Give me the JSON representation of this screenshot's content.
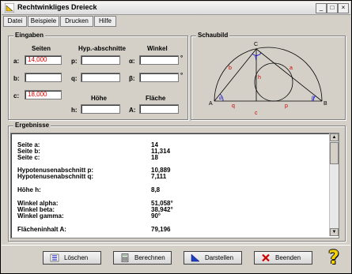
{
  "window": {
    "title": "Rechtwinkliges Dreieck"
  },
  "menu": [
    "Datei",
    "Beispiele",
    "Drucken",
    "Hilfe"
  ],
  "eingaben": {
    "title": "Eingaben",
    "col_seiten": "Seiten",
    "col_hyp": "Hyp.-abschnitte",
    "col_winkel": "Winkel",
    "row_a": "a:",
    "row_b": "b:",
    "row_c": "c:",
    "p_label": "p:",
    "q_label": "q:",
    "alpha_label": "α:",
    "beta_label": "β:",
    "deg1": "°",
    "deg2": "°",
    "hoehe_title": "Höhe",
    "flaeche_title": "Fläche",
    "h_label": "h:",
    "A_label": "A:",
    "a_value": "14,000",
    "b_value": "",
    "c_value": "18,000",
    "p_value": "",
    "q_value": "",
    "alpha_value": "",
    "beta_value": "",
    "h_value": "",
    "A_value": ""
  },
  "schaubild": {
    "title": "Schaubild",
    "vertex_A": "A",
    "vertex_B": "B",
    "vertex_C": "C",
    "side_a": "a",
    "side_b": "b",
    "side_c": "c",
    "seg_p": "p",
    "seg_q": "q",
    "height": "h",
    "angle_alpha": "α",
    "angle_beta": "β",
    "angle_gamma": "γ"
  },
  "ergebnisse": {
    "title": "Ergebnisse",
    "rows": [
      {
        "label": "Seite a:",
        "value": "14"
      },
      {
        "label": "Seite b:",
        "value": "11,314"
      },
      {
        "label": "Seite c:",
        "value": "18"
      },
      {
        "label": "Hypotenusenabschnitt p:",
        "value": "10,889"
      },
      {
        "label": "Hypotenusenabschnitt q:",
        "value": "7,111"
      },
      {
        "label": "Höhe h:",
        "value": "8,8"
      },
      {
        "label": "Winkel alpha:",
        "value": "51,058°"
      },
      {
        "label": "Winkel beta:",
        "value": "38,942°"
      },
      {
        "label": "Winkel gamma:",
        "value": "90°"
      },
      {
        "label": "Flächeninhalt A:",
        "value": "79,196"
      }
    ]
  },
  "buttons": {
    "loeschen": "Löschen",
    "berechnen": "Berechnen",
    "darstellen": "Darstellen",
    "beenden": "Beenden",
    "help": "?"
  },
  "colors": {
    "input_text": "#e00000",
    "diagram_red": "#cc0000",
    "diagram_blue": "#0000cc"
  }
}
